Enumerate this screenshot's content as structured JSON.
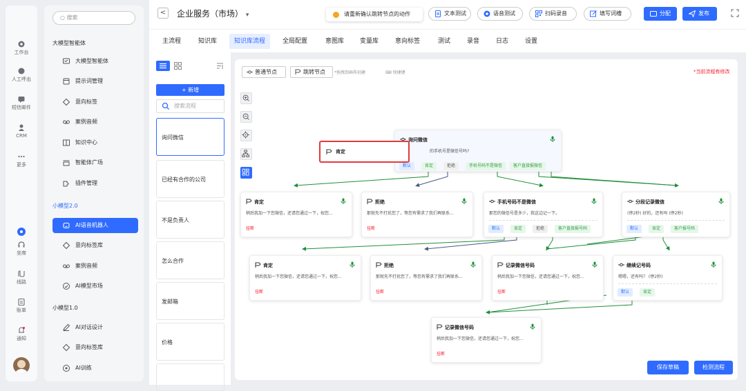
{
  "rail": {
    "items": [
      {
        "label": "工作台",
        "icon": "workbench-icon"
      },
      {
        "label": "人工呼出",
        "icon": "outbound-call-icon"
      },
      {
        "label": "短信邮件",
        "icon": "message-icon"
      },
      {
        "label": "CRM",
        "icon": "crm-icon"
      },
      {
        "label": "更多",
        "icon": "more-icon"
      }
    ],
    "bottom": [
      {
        "label": "坐席",
        "icon": "seat-icon"
      },
      {
        "label": "线路",
        "icon": "line-icon"
      },
      {
        "label": "账单",
        "icon": "bill-icon"
      },
      {
        "label": "通知",
        "icon": "bell-icon"
      }
    ]
  },
  "menu": {
    "search_placeholder": "搜索",
    "section1": "大模型智能体",
    "items1": [
      "大模型智能体",
      "提示词管理",
      "意向标签",
      "案例音频",
      "知识中心",
      "智能体广场",
      "插件管理"
    ],
    "section2": "小模型2.0",
    "items2": [
      "AI语音机器人",
      "意向标签库",
      "案例音频",
      "AI模型市场"
    ],
    "section3": "小模型1.0",
    "items3": [
      "AI对话设计",
      "意向标签库",
      "AI训练"
    ]
  },
  "header": {
    "back": "<",
    "title": "企业服务（市场）",
    "dropdown": "▾",
    "toast": "请重新确认跳转节点的动作",
    "buttons": [
      "文本测试",
      "语音测试",
      "扫码录音",
      "填写词槽",
      "分配",
      "发布"
    ]
  },
  "tabs": [
    "主流程",
    "知识库",
    "知识库流程",
    "全局配置",
    "意图库",
    "变量库",
    "意向标签",
    "测试",
    "录音",
    "日志",
    "设置"
  ],
  "active_tab": "知识库流程",
  "flow_list": {
    "add_label": "+ 新增",
    "search_placeholder": "搜索流程",
    "items": [
      "询问微信",
      "已经有合作的公司",
      "不是负责人",
      "怎么合作",
      "发邮箱",
      "价格"
    ]
  },
  "canvas": {
    "tool_normal": "普通节点",
    "tool_jump": "跳转节点",
    "hint": "*拖拽到画布创建",
    "shortcut": "快捷键",
    "modified": "*当前流程有修改",
    "popup_label": "肯定",
    "root": {
      "title": "询问微信",
      "desc": "的手机号是微信号吗?",
      "tags": [
        "默认",
        "肯定",
        "拒绝",
        "手机号码不是微信",
        "客户直接报微信"
      ]
    },
    "row1": [
      {
        "title": "肯定",
        "desc": "稍后我加一下您微信，还请您通过一下，祝您...",
        "hang": "挂断"
      },
      {
        "title": "拒绝",
        "desc": "那就先不打扰您了，等您有需求了我们再联系...",
        "hang": "挂断"
      },
      {
        "title": "手机号码不是微信",
        "desc": "那您的微信号是多少，我这边记一下。",
        "tags": [
          "默认",
          "肯定",
          "拒绝",
          "客户直接报号码"
        ]
      },
      {
        "title": "分段记录微信",
        "desc": "(停2秒) 好的，还有吗 (停2秒)",
        "tags": [
          "默认",
          "肯定",
          "客户报号码"
        ]
      }
    ],
    "row2": [
      {
        "title": "肯定",
        "desc": "稍后我加一下您微信，还请您通过一下，祝您...",
        "hang": "挂断"
      },
      {
        "title": "拒绝",
        "desc": "那就先不打扰您了，等您有需求了我们再联系...",
        "hang": "挂断"
      },
      {
        "title": "记录微信号码",
        "desc": "稍后我加一下您微信，还请您通过一下，祝您...",
        "hang": "挂断"
      },
      {
        "title": "继续记号码",
        "desc": "嗯嗯，还有吗？ (停2秒)",
        "tags": [
          "默认",
          "肯定"
        ]
      }
    ],
    "row3": {
      "title": "记录微信号码",
      "desc": "稍后我加一下您微信，还请您通过一下，祝您...",
      "hang": "挂断"
    },
    "save": "保存草稿",
    "check": "检测流程"
  },
  "colors": {
    "accent": "#2f6bff",
    "danger": "#f5222d",
    "tag_green": "#389e4a",
    "warn": "#f5a623"
  }
}
